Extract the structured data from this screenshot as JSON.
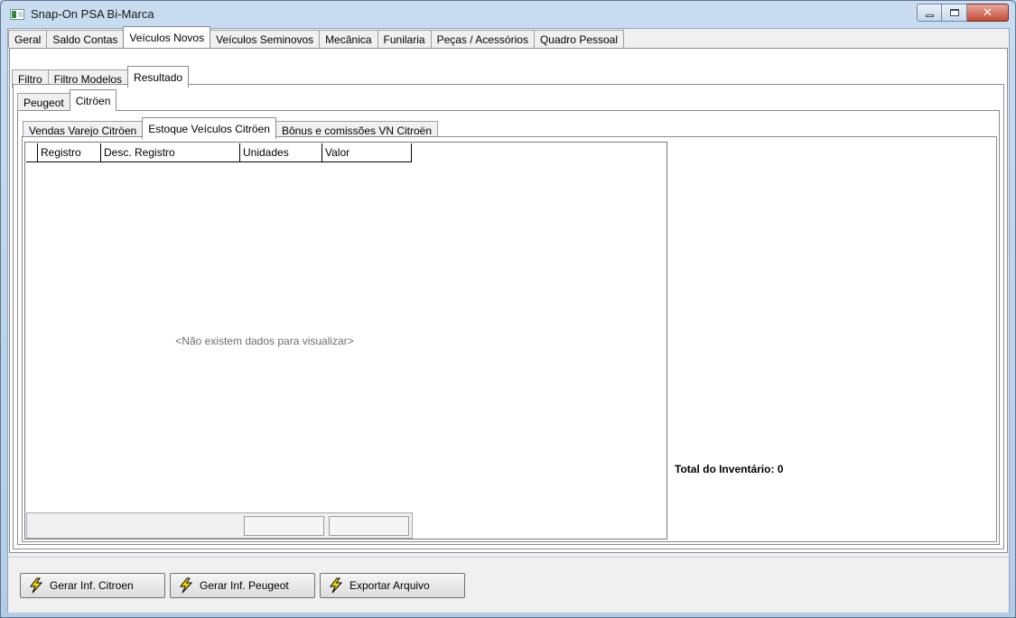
{
  "window": {
    "title": "Snap-On PSA Bi-Marca"
  },
  "main_tabs": [
    {
      "label": "Geral"
    },
    {
      "label": "Saldo Contas"
    },
    {
      "label": "Veículos Novos",
      "active": true
    },
    {
      "label": "Veículos Seminovos"
    },
    {
      "label": "Mecânica"
    },
    {
      "label": "Funilaria"
    },
    {
      "label": "Peças / Acessórios"
    },
    {
      "label": "Quadro Pessoal"
    }
  ],
  "sub_tabs": [
    {
      "label": "Filtro"
    },
    {
      "label": "Filtro Modelos"
    },
    {
      "label": "Resultado",
      "active": true
    }
  ],
  "brand_tabs": [
    {
      "label": "Peugeot"
    },
    {
      "label": "Citröen",
      "active": true
    }
  ],
  "report_tabs": [
    {
      "label": "Vendas Varejo Citröen"
    },
    {
      "label": "Estoque Veículos Citröen",
      "active": true
    },
    {
      "label": "Bônus e comissões VN Citroën"
    }
  ],
  "grid": {
    "columns": [
      "Registro",
      "Desc. Registro",
      "Unidades",
      "Valor"
    ],
    "empty_message": "<Não existem dados para visualizar>"
  },
  "summary": {
    "total_label": "Total do Inventário:",
    "total_value": "0"
  },
  "buttons": {
    "gerar_citroen": "Gerar Inf. Citroen",
    "gerar_peugeot": "Gerar Inf. Peugeot",
    "exportar": "Exportar Arquivo"
  },
  "icons": {
    "app": "app-window-icon",
    "action": "lightning-icon"
  },
  "colors": {
    "lightning_fill": "#f5d800",
    "close_button": "#c24b34"
  }
}
